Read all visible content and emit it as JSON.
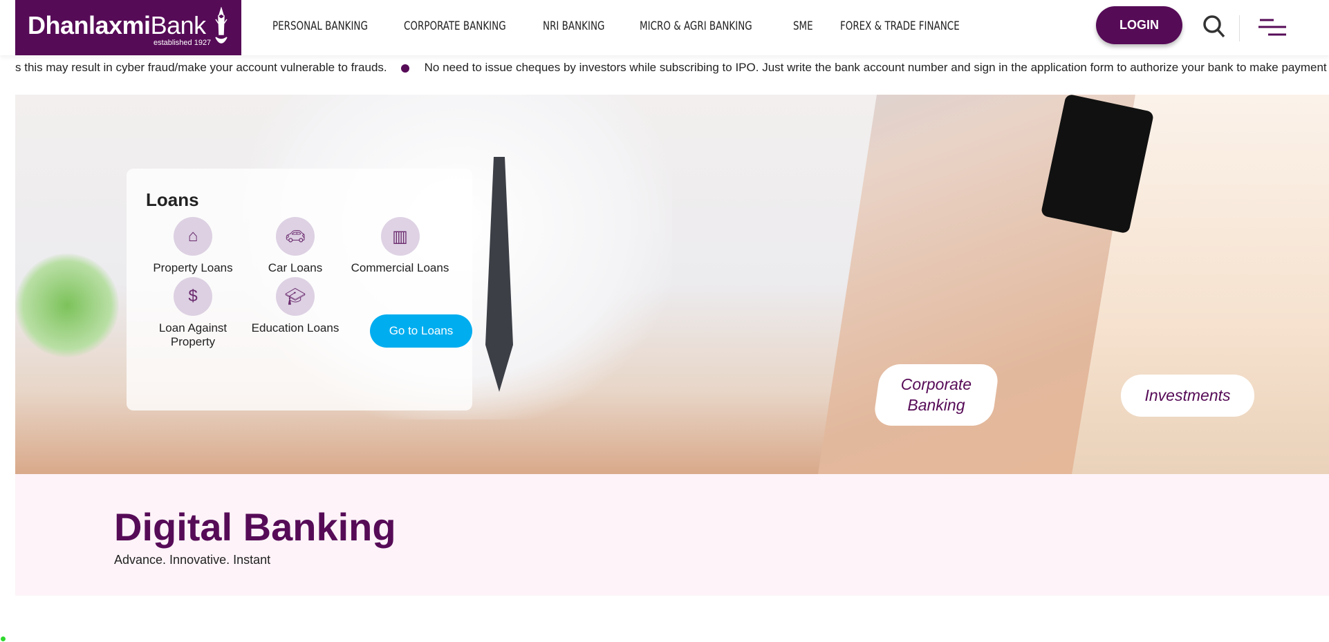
{
  "header": {
    "logo": {
      "brand_bold": "Dhanlaxmi",
      "brand_light": "Bank",
      "tagline": "established 1927"
    },
    "nav": [
      "PERSONAL BANKING",
      "CORPORATE BANKING",
      "NRI BANKING",
      "MICRO & AGRI BANKING",
      "SME",
      "FOREX & TRADE FINANCE"
    ],
    "login_label": "LOGIN",
    "search_icon": "search-icon",
    "menu_icon": "hamburger-icon"
  },
  "ticker": [
    "s this may result in cyber fraud/make your account vulnerable to frauds.",
    "No need to issue cheques by investors while subscribing to IPO. Just write the bank account number and sign in the application form to authorize your bank to make payment in case of"
  ],
  "banner": {
    "loans": {
      "title": "Loans",
      "items": [
        {
          "label": "Property Loans",
          "icon": "house-in-hand-icon"
        },
        {
          "label": "Car Loans",
          "icon": "car-icon"
        },
        {
          "label": "Commercial Loans",
          "icon": "building-icon"
        },
        {
          "label": "Loan Against Property",
          "icon": "money-bag-icon"
        },
        {
          "label": "Education Loans",
          "icon": "graduation-cap-icon"
        }
      ],
      "cta": "Go to Loans"
    },
    "corporate": "Corporate Banking",
    "investments": "Investments"
  },
  "digital": {
    "title": "Digital Banking",
    "subtitle": "Advance. Innovative. Instant"
  },
  "colors": {
    "brand": "#560b57",
    "cta": "#00adef",
    "section_bg": "#fdf3f8"
  }
}
